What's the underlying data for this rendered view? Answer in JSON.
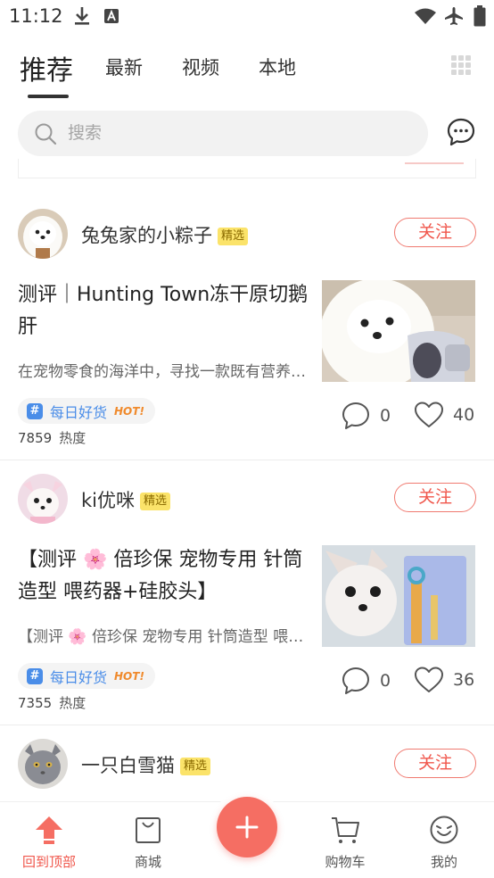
{
  "status_bar": {
    "time": "11:12"
  },
  "tabs": [
    {
      "label": "推荐"
    },
    {
      "label": "最新"
    },
    {
      "label": "视频"
    },
    {
      "label": "本地"
    }
  ],
  "search": {
    "placeholder": "搜索"
  },
  "posts": [
    {
      "username": "兔兔家的小粽子",
      "badge": "精选",
      "follow_label": "关注",
      "title": "测评｜Hunting Town冻干原切鹅肝",
      "excerpt": "在宠物零食的海洋中，寻找一款既有营养又美味的零食",
      "topic": "每日好货",
      "topic_hot": "HOT!",
      "heat_value": "7859",
      "heat_label": "热度",
      "comments": "0",
      "likes": "40"
    },
    {
      "username": "ki优咪",
      "badge": "精选",
      "follow_label": "关注",
      "title": "【测评 🌸 倍珍保 宠物专用 针筒造型 喂药器+硅胶头】",
      "excerpt": "【测评 🌸 倍珍保 宠物专用 针筒造型 喂药器+硅胶头】",
      "topic": "每日好货",
      "topic_hot": "HOT!",
      "heat_value": "7355",
      "heat_label": "热度",
      "comments": "0",
      "likes": "36"
    },
    {
      "username": "一只白雪猫",
      "badge": "精选",
      "follow_label": "关注"
    }
  ],
  "bottom_nav": [
    {
      "label": "回到顶部",
      "active": true
    },
    {
      "label": "商城"
    },
    {
      "label": "购物车"
    },
    {
      "label": "我的"
    }
  ],
  "colors": {
    "accent": "#f0574c",
    "topic_blue": "#4a8de8",
    "badge_yellow": "#fbe36a"
  }
}
